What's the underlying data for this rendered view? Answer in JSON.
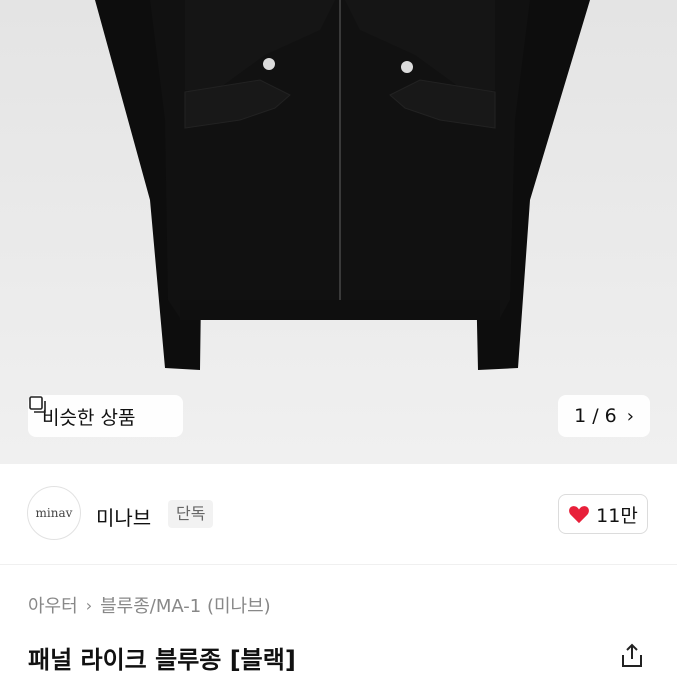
{
  "hero": {
    "similar_label": "비슷한 상품",
    "counter": "1 / 6",
    "similar_icon": "similar-products-icon",
    "next_icon": "chevron-right-icon"
  },
  "brand": {
    "logo_text": "minav",
    "name": "미나브",
    "badge": "단독"
  },
  "like": {
    "count": "11만",
    "icon": "heart-icon",
    "color": "#e8203a"
  },
  "breadcrumb": {
    "category": "아우터",
    "subcategory": "블루종/MA-1 (미나브)"
  },
  "product": {
    "title": "패널 라이크 블루종 [블랙]",
    "share_icon": "share-icon"
  }
}
